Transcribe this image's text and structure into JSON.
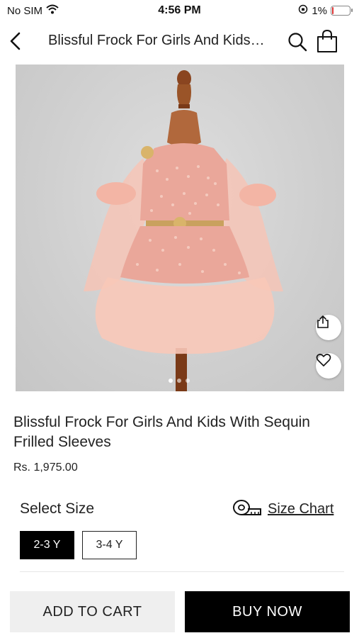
{
  "status_bar": {
    "carrier": "No SIM",
    "time": "4:56 PM",
    "battery_text": "1%",
    "battery_level": 0.01,
    "battery_color": "#dd3333"
  },
  "header": {
    "title": "Blissful Frock For Girls And Kids With Sequin Frilled Sleeves",
    "back_icon": "chevron-left-icon",
    "search_icon": "search-icon",
    "bag_icon": "shopping-bag-icon"
  },
  "gallery": {
    "image_count": 3,
    "active_index": 0,
    "share_icon": "share-icon",
    "wishlist_icon": "heart-icon"
  },
  "product": {
    "name": "Blissful Frock For Girls And Kids With Sequin Frilled Sleeves",
    "price": "Rs. 1,975.00"
  },
  "size": {
    "label": "Select Size",
    "chart_label": "Size Chart",
    "chart_icon": "measuring-tape-icon",
    "options": [
      "2-3 Y",
      "3-4 Y"
    ],
    "selected": "2-3 Y"
  },
  "actions": {
    "add_to_cart": "ADD TO CART",
    "buy_now": "BUY NOW"
  },
  "colors": {
    "primary": "#000000",
    "secondary_button": "#efefef",
    "dress": "#f4b7a6"
  }
}
